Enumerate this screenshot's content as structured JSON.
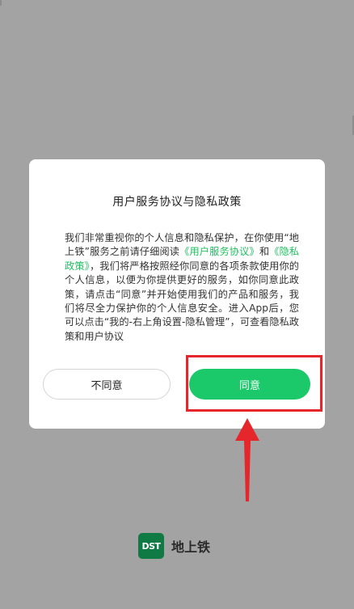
{
  "dialog": {
    "title": "用户服务协议与隐私政策",
    "body_part1": "我们非常重视你的个人信息和隐私保护，在你使用“地上铁”服务之前请仔细阅读",
    "link_user_agreement": "《用户服务协议》",
    "body_and": "和",
    "link_privacy_policy": "《隐私政策》",
    "body_part2": "，我们将严格按照经你同意的各项条款使用你的个人信息，以便为你提供更好的服务，如你同意此政策，请点击“同意”并开始使用我们的产品和服务，我们将尽全力保护你的个人信息安全。进入App后，您可以点击“我的-右上角设置-隐私管理”，可查看隐私政策和用户协议",
    "disagree_label": "不同意",
    "agree_label": "同意"
  },
  "brand": {
    "logo_text": "DST",
    "name": "地上铁"
  },
  "colors": {
    "accent": "#1bc96a",
    "link": "#1fbf5f",
    "annotation": "#e5262b",
    "overlay": "#a3a3a3"
  }
}
